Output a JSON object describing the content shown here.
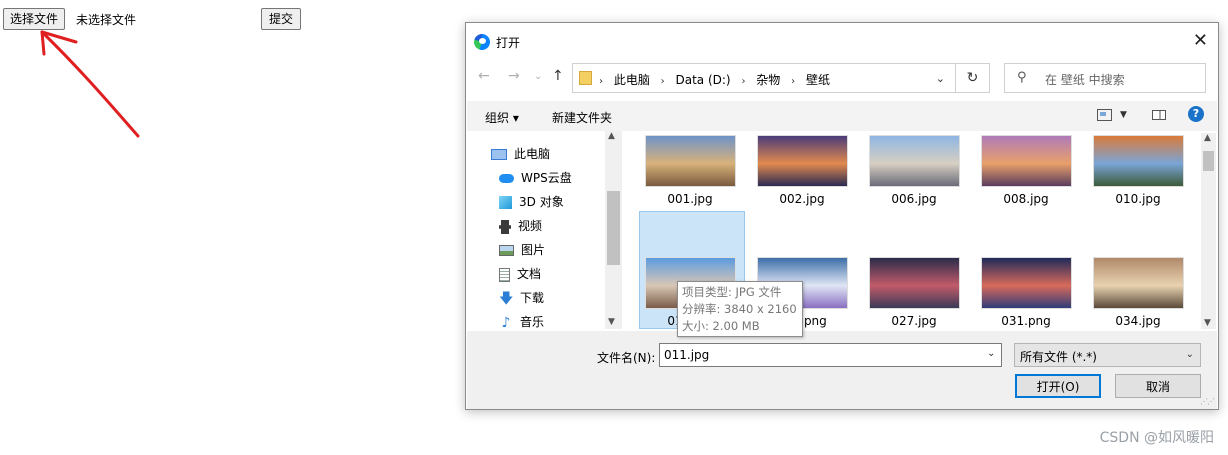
{
  "page": {
    "choose_file_label": "选择文件",
    "no_file_text": "未选择文件",
    "submit_label": "提交",
    "watermark": "CSDN @如风暖阳"
  },
  "dialog": {
    "title": "打开",
    "breadcrumbs": [
      "此电脑",
      "Data (D:)",
      "杂物",
      "壁纸"
    ],
    "search_placeholder": "在 壁纸 中搜索",
    "toolbar": {
      "organize": "组织 ▾",
      "new_folder": "新建文件夹"
    },
    "nav_items": [
      {
        "label": "此电脑",
        "icon": "computer-icon"
      },
      {
        "label": "WPS云盘",
        "icon": "cloud-icon"
      },
      {
        "label": "3D 对象",
        "icon": "cube-icon"
      },
      {
        "label": "视频",
        "icon": "video-icon"
      },
      {
        "label": "图片",
        "icon": "picture-icon"
      },
      {
        "label": "文档",
        "icon": "document-icon"
      },
      {
        "label": "下载",
        "icon": "download-icon"
      },
      {
        "label": "音乐",
        "icon": "music-icon"
      }
    ],
    "files": [
      {
        "name": "001.jpg",
        "colors": [
          "#6f93c8",
          "#d8b27a",
          "#7a5a3e"
        ]
      },
      {
        "name": "002.jpg",
        "colors": [
          "#4a3c7a",
          "#e38a4e",
          "#2a2a52"
        ]
      },
      {
        "name": "006.jpg",
        "colors": [
          "#8fb6e3",
          "#d7cfc2",
          "#6b6b7a"
        ]
      },
      {
        "name": "008.jpg",
        "colors": [
          "#b07ab8",
          "#e8a06a",
          "#5a3c5e"
        ]
      },
      {
        "name": "010.jpg",
        "colors": [
          "#d97a3a",
          "#7aa5d6",
          "#3d5a3a"
        ]
      },
      {
        "name": "011.jpg",
        "colors": [
          "#5b9be0",
          "#d9c7b5",
          "#7a5d4a"
        ]
      },
      {
        "name": "017.png",
        "colors": [
          "#3c6ea8",
          "#e0e6f5",
          "#8a6fc1"
        ]
      },
      {
        "name": "027.jpg",
        "colors": [
          "#2a2c4a",
          "#c25b6a",
          "#3a3a55"
        ]
      },
      {
        "name": "031.png",
        "colors": [
          "#1f2a5a",
          "#d86a5a",
          "#2f3c7a"
        ]
      },
      {
        "name": "034.jpg",
        "colors": [
          "#b08a6a",
          "#e8d2b0",
          "#5a4a3a"
        ]
      }
    ],
    "tooltip": {
      "type_line": "项目类型: JPG 文件",
      "resolution_line": "分辨率: 3840 x 2160",
      "size_line": "大小: 2.00 MB"
    },
    "filename_label": "文件名(N):",
    "filename_value": "011.jpg",
    "filetype_value": "所有文件 (*.*)",
    "open_label": "打开(O)",
    "cancel_label": "取消"
  },
  "colors": {
    "selection": "#cce4f7",
    "accent": "#0078d7",
    "arrow": "#e02020"
  }
}
